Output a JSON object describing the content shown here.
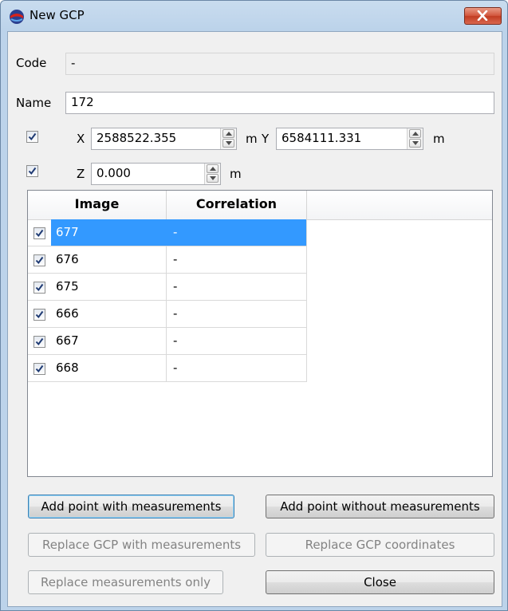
{
  "window": {
    "title": "New GCP",
    "title_icon": "gcp-globe-icon",
    "close_icon": "close-icon",
    "close_color": "#c7432a"
  },
  "code": {
    "label": "Code",
    "value": "-"
  },
  "name": {
    "label": "Name",
    "value": "172"
  },
  "coords": {
    "xy_checked": true,
    "x_label": "X",
    "x_value": "2588522.355",
    "x_unit": "m",
    "y_label": "Y",
    "y_value": "6584111.331",
    "y_unit": "m",
    "z_checked": true,
    "z_label": "Z",
    "z_value": "0.000",
    "z_unit": "m"
  },
  "table": {
    "columns": [
      "Image",
      "Correlation"
    ],
    "rows": [
      {
        "image": "677",
        "correlation": "-",
        "checked": true,
        "selected": true
      },
      {
        "image": "676",
        "correlation": "-",
        "checked": true,
        "selected": false
      },
      {
        "image": "675",
        "correlation": "-",
        "checked": true,
        "selected": false
      },
      {
        "image": "666",
        "correlation": "-",
        "checked": true,
        "selected": false
      },
      {
        "image": "667",
        "correlation": "-",
        "checked": true,
        "selected": false
      },
      {
        "image": "668",
        "correlation": "-",
        "checked": true,
        "selected": false
      }
    ],
    "selection_color": "#3399ff"
  },
  "buttons": {
    "add_with": "Add point with measurements",
    "add_without": "Add point without measurements",
    "replace_gcp_meas": "Replace GCP with measurements",
    "replace_coords": "Replace GCP coordinates",
    "replace_meas_only": "Replace measurements only",
    "close": "Close"
  }
}
